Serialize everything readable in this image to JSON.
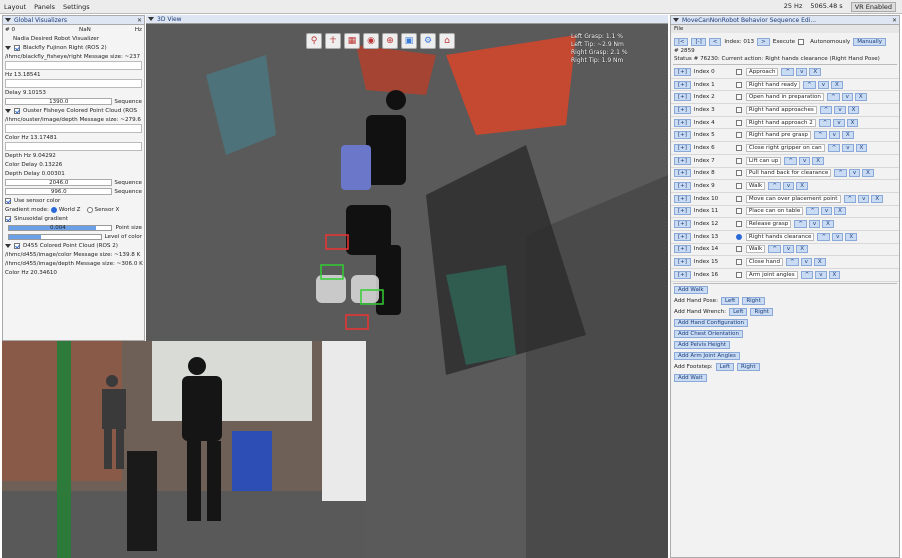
{
  "menubar": {
    "items": [
      "Layout",
      "Panels",
      "Settings"
    ],
    "rate": "25 Hz",
    "time": "5065.48 s",
    "vr": "VR Enabled"
  },
  "left": {
    "title": "Global Visualizers",
    "hash": "# 0",
    "nan": "NaN",
    "hz": "Hz",
    "robot": "Nadia Desired Robot Visualizer",
    "fisheye": {
      "label": "Blackfly Fujinon Right (ROS 2)",
      "topic": "/ihmc/blackfly_fisheye/right  Message size: ~237",
      "hz": "Hz 13.18541",
      "delay": "Delay 9.10153",
      "seq_val": "1390.0",
      "seq": "Sequence"
    },
    "ouster": {
      "label": "Ouster Fisheye Colored Point Cloud (ROS",
      "topic": "/ihmc/ouster/image/depth  Message size: ~279.6",
      "color": "Color  Hz 13.17481",
      "depth_hz": "Depth  Hz 9.04292",
      "delay": "Color  Delay 0.13226",
      "depth_delay": "Depth  Delay 0.00301",
      "seq1": "2046.0",
      "seq2": "996.0",
      "seq": "Sequence"
    },
    "sensor_color": "Use sensor color",
    "gradient_mode": "Gradient mode:",
    "world_z": "World Z",
    "sensor_x": "Sensor X",
    "sinusoidal": "Sinusoidal gradient",
    "point_size": "0.004",
    "point_size_label": "Point size",
    "level_label": "Level of color",
    "d455": {
      "label": "D455 Colored Point Cloud (ROS 2)",
      "topic1": "/ihmc/d455/image/color  Message size: ~139.8 K",
      "topic2": "/ihmc/d455/image/depth  Message size: ~306.0 K",
      "color": "Color  Hz 20.34610"
    },
    "sliders": {
      "point_size": 0.85,
      "level": 0.35
    }
  },
  "view": {
    "title": "3D View",
    "hud": [
      "Left Grasp: 1.1 %",
      "Left Tip: ~2.9 Nm",
      "Right Grasp: 2.1 %",
      "Right Tip: 1.9 Nm"
    ],
    "tools": [
      "person-walk-icon",
      "person-arms-icon",
      "grid-icon",
      "toggle-icon",
      "target-icon",
      "robot-icon",
      "robot-cog-icon",
      "home-icon"
    ]
  },
  "right": {
    "title": "MoveCanNonRobot Behavior Sequence Edi...",
    "file": "File",
    "index_label": "Index: 013",
    "execute": "Execute",
    "autonomously": "Autonomously",
    "manually": "Manually",
    "hash": "# 2859",
    "status": "Status # 76230: Current action:  Right hands clearance (Right Hand Pose)",
    "rows": [
      {
        "idx": "Index 0",
        "desc": "Approach",
        "cur": false
      },
      {
        "idx": "Index 1",
        "desc": "Right hand ready",
        "cur": false
      },
      {
        "idx": "Index 2",
        "desc": "Open hand in preparation",
        "cur": false
      },
      {
        "idx": "Index 3",
        "desc": "Right hand approaches",
        "cur": false
      },
      {
        "idx": "Index 4",
        "desc": "Right hand approach 2",
        "cur": false
      },
      {
        "idx": "Index 5",
        "desc": "Right hand pre grasp",
        "cur": false
      },
      {
        "idx": "Index 6",
        "desc": "Close right gripper on can",
        "cur": false
      },
      {
        "idx": "Index 7",
        "desc": "Lift can up",
        "cur": false
      },
      {
        "idx": "Index 8",
        "desc": "Pull hand back for clearance",
        "cur": false
      },
      {
        "idx": "Index 9",
        "desc": "Walk",
        "cur": false
      },
      {
        "idx": "Index 10",
        "desc": "Move can over placement point",
        "cur": false
      },
      {
        "idx": "Index 11",
        "desc": "Place can on table",
        "cur": false
      },
      {
        "idx": "Index 12",
        "desc": "Release grasp",
        "cur": false
      },
      {
        "idx": "Index 13",
        "desc": "Right hands clearance",
        "cur": true
      },
      {
        "idx": "Index 14",
        "desc": "Walk",
        "cur": false
      },
      {
        "idx": "Index 15",
        "desc": "Close hand",
        "cur": false
      },
      {
        "idx": "Index 16",
        "desc": "Arm joint angles",
        "cur": false
      }
    ],
    "add_walk": "Add Walk",
    "add_hand_pose": "Add Hand Pose:",
    "add_hand_wrench": "Add Hand Wrench:",
    "left": "Left",
    "right": "Right",
    "add_hand_config": "Add Hand Configuration",
    "add_chest": "Add Chest Orientation",
    "add_pelvis": "Add Pelvis Height",
    "add_arm": "Add Arm Joint Angles",
    "add_footstep": "Add Footstep:",
    "add_wait": "Add Wait"
  },
  "colors": {
    "accent": "#2a6ad8",
    "tab": "#dde6f2",
    "blue_btn": "#c9dcf4"
  }
}
